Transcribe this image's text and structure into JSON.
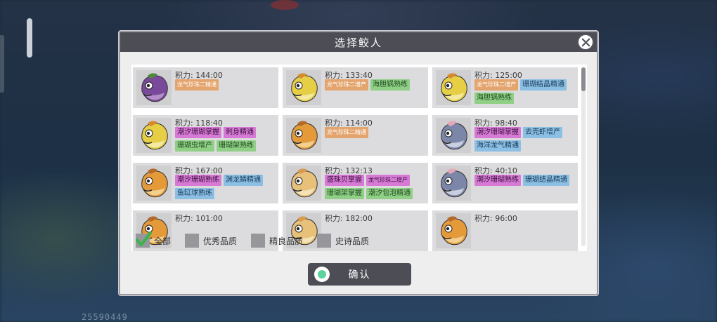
{
  "background": {
    "bottom_code": "25590449"
  },
  "dialog": {
    "title": "选择鲛人",
    "close_icon": "close-icon"
  },
  "cards": [
    {
      "stamina": "积力: 144:00",
      "portrait": "purple-fish",
      "tags": [
        {
          "text": "龙气珍珠二精通",
          "color": "orange",
          "small": true
        }
      ]
    },
    {
      "stamina": "积力: 133:40",
      "portrait": "yellow-fish",
      "tags": [
        {
          "text": "龙气珍珠二增产",
          "color": "orange",
          "small": true
        },
        {
          "text": "海胆锅熟练",
          "color": "green"
        }
      ]
    },
    {
      "stamina": "积力: 125:00",
      "portrait": "yellow-fish",
      "tags": [
        {
          "text": "龙气珍珠二增产",
          "color": "orange",
          "small": true
        },
        {
          "text": "珊瑚结晶精通",
          "color": "blue"
        },
        {
          "text": "海胆锅熟练",
          "color": "green"
        }
      ]
    },
    {
      "stamina": "积力: 118:40",
      "portrait": "yellow-fish",
      "tags": [
        {
          "text": "潮汐珊瑚掌握",
          "color": "magenta"
        },
        {
          "text": "刺身精通",
          "color": "magenta"
        },
        {
          "text": "珊瑚虫增产",
          "color": "green"
        },
        {
          "text": "珊瑚架熟练",
          "color": "green"
        }
      ]
    },
    {
      "stamina": "积力: 114:00",
      "portrait": "orange-fish",
      "tags": [
        {
          "text": "龙气珍珠二精通",
          "color": "orange",
          "small": true
        }
      ]
    },
    {
      "stamina": "积力: 98:40",
      "portrait": "pink-fish",
      "tags": [
        {
          "text": "潮汐珊瑚掌握",
          "color": "magenta"
        },
        {
          "text": "去壳虾增产",
          "color": "blue"
        },
        {
          "text": "海洋龙气精通",
          "color": "blue"
        }
      ]
    },
    {
      "stamina": "积力: 167:00",
      "portrait": "orange-fish",
      "tags": [
        {
          "text": "潮汐珊瑚熟练",
          "color": "magenta"
        },
        {
          "text": "渊龙鳞精通",
          "color": "blue"
        },
        {
          "text": "鱼缸球熟练",
          "color": "blue"
        }
      ]
    },
    {
      "stamina": "积力: 132:13",
      "portrait": "cream-fish",
      "tags": [
        {
          "text": "盛珠贝掌握",
          "color": "magenta"
        },
        {
          "text": "龙气珍珠二增产",
          "color": "magenta",
          "small": true
        },
        {
          "text": "珊瑚架掌握",
          "color": "green"
        },
        {
          "text": "潮汐包泡精通",
          "color": "green"
        }
      ]
    },
    {
      "stamina": "积力: 40:10",
      "portrait": "pink-fish",
      "tags": [
        {
          "text": "潮汐珊瑚熟练",
          "color": "magenta"
        },
        {
          "text": "珊瑚结晶精通",
          "color": "blue"
        }
      ]
    },
    {
      "stamina": "积力: 101:00",
      "portrait": "orange-fish",
      "tags": []
    },
    {
      "stamina": "积力: 182:00",
      "portrait": "cream-fish",
      "tags": []
    },
    {
      "stamina": "积力: 96:00",
      "portrait": "orange-fish",
      "tags": []
    }
  ],
  "filters": [
    {
      "label": "全部",
      "checked": true
    },
    {
      "label": "优秀品质",
      "checked": false
    },
    {
      "label": "精良品质",
      "checked": false
    },
    {
      "label": "史诗品质",
      "checked": false
    }
  ],
  "confirm": {
    "label": "确认"
  },
  "colors": {
    "title_bar": "#4c4d55",
    "tag_orange": "#e4a46e",
    "tag_green": "#8fcf86",
    "tag_magenta": "#d77ad6",
    "tag_blue": "#8cbfe4",
    "check_green": "#3cb34a"
  }
}
